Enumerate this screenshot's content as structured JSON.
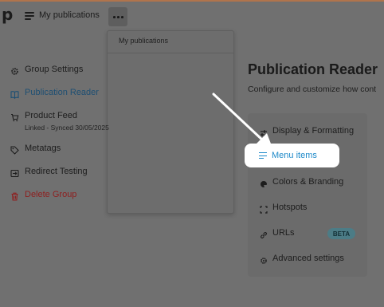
{
  "topbar": {
    "logo": "p",
    "breadcrumb": "My publications"
  },
  "dropdown": {
    "header": "My publications",
    "items": [
      {
        "label": "Group Settings",
        "icon": "gear-icon"
      },
      {
        "label": "Publication Reader",
        "icon": "book-icon",
        "active": true
      },
      {
        "label": "Product Feed",
        "icon": "cart-icon",
        "sub": "Linked - Synced 30/05/2025"
      },
      {
        "label": "Metatags",
        "icon": "tag-icon"
      },
      {
        "label": "Redirect Testing",
        "icon": "redirect-icon"
      },
      {
        "label": "Delete Group",
        "icon": "trash-icon",
        "danger": true
      }
    ]
  },
  "main": {
    "title": "Publication Reader",
    "subtitle": "Configure and customize how cont"
  },
  "settings_nav": {
    "items": [
      {
        "label": "Display & Formatting",
        "icon": "display-icon"
      },
      {
        "label": "Menu items",
        "icon": "menu-icon",
        "highlighted": true
      },
      {
        "label": "Colors & Branding",
        "icon": "palette-icon"
      },
      {
        "label": "Hotspots",
        "icon": "hotspot-icon"
      },
      {
        "label": "URLs",
        "icon": "link-icon",
        "badge": "BETA"
      },
      {
        "label": "Advanced settings",
        "icon": "gear-icon"
      }
    ]
  },
  "colors": {
    "accent_blue": "#1f8ac9",
    "danger_red": "#8e2020",
    "active_blue": "#1e4f73"
  }
}
